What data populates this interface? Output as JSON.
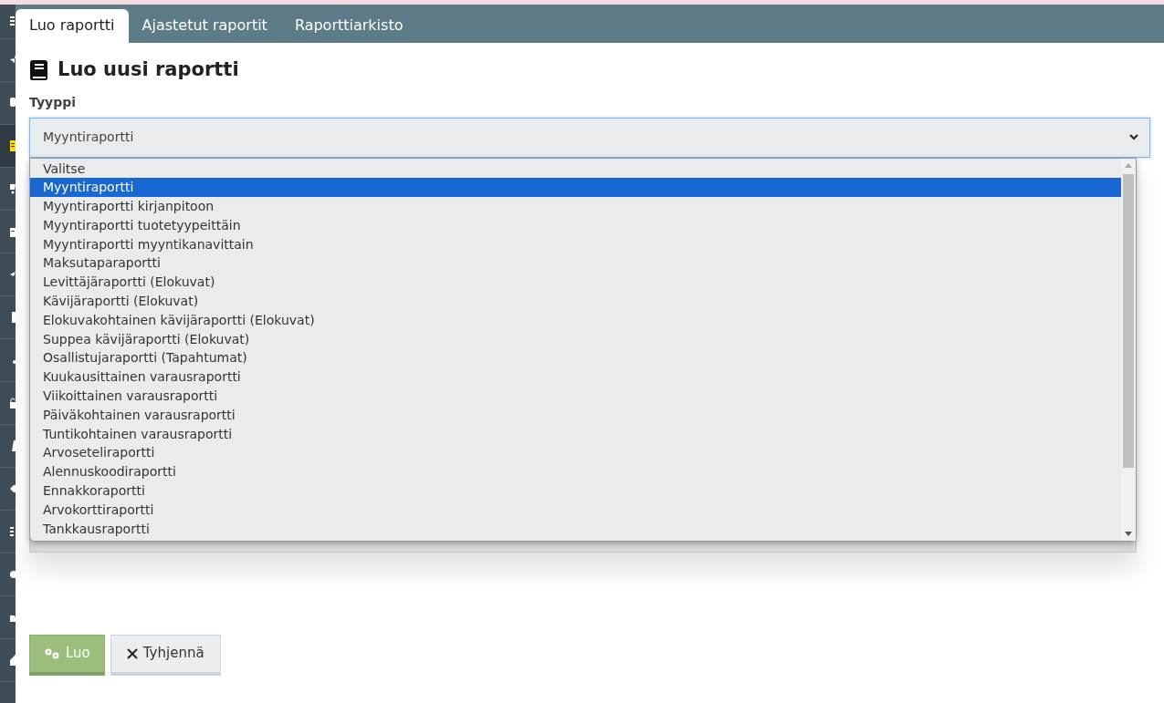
{
  "tabs": [
    {
      "label": "Luo raportti",
      "selected": true
    },
    {
      "label": "Ajastetut raportit",
      "selected": false
    },
    {
      "label": "Raporttiarkisto",
      "selected": false
    }
  ],
  "heading": "Luo uusi raportti",
  "type_field": {
    "label": "Tyyppi",
    "value": "Myyntiraportti",
    "options": [
      {
        "label": "Valitse",
        "selected": false
      },
      {
        "label": "Myyntiraportti",
        "selected": true
      },
      {
        "label": "Myyntiraportti kirjanpitoon",
        "selected": false
      },
      {
        "label": "Myyntiraportti tuotetyypeittäin",
        "selected": false
      },
      {
        "label": "Myyntiraportti myyntikanavittain",
        "selected": false
      },
      {
        "label": "Maksutaparaportti",
        "selected": false
      },
      {
        "label": "Levittäjäraportti (Elokuvat)",
        "selected": false
      },
      {
        "label": "Kävijäraportti (Elokuvat)",
        "selected": false
      },
      {
        "label": "Elokuvakohtainen kävijäraportti (Elokuvat)",
        "selected": false
      },
      {
        "label": "Suppea kävijäraportti (Elokuvat)",
        "selected": false
      },
      {
        "label": "Osallistujaraportti (Tapahtumat)",
        "selected": false
      },
      {
        "label": "Kuukausittainen varausraportti",
        "selected": false
      },
      {
        "label": "Viikoittainen varausraportti",
        "selected": false
      },
      {
        "label": "Päiväkohtainen varausraportti",
        "selected": false
      },
      {
        "label": "Tuntikohtainen varausraportti",
        "selected": false
      },
      {
        "label": "Arvoseteliraportti",
        "selected": false
      },
      {
        "label": "Alennuskoodiraportti",
        "selected": false
      },
      {
        "label": "Ennakkoraportti",
        "selected": false
      },
      {
        "label": "Arvokorttiraportti",
        "selected": false
      },
      {
        "label": "Tankkausraportti",
        "selected": false
      }
    ]
  },
  "buttons": [
    {
      "kind": "create",
      "label": "Luo"
    },
    {
      "kind": "clear",
      "label": "Tyhjennä"
    }
  ]
}
